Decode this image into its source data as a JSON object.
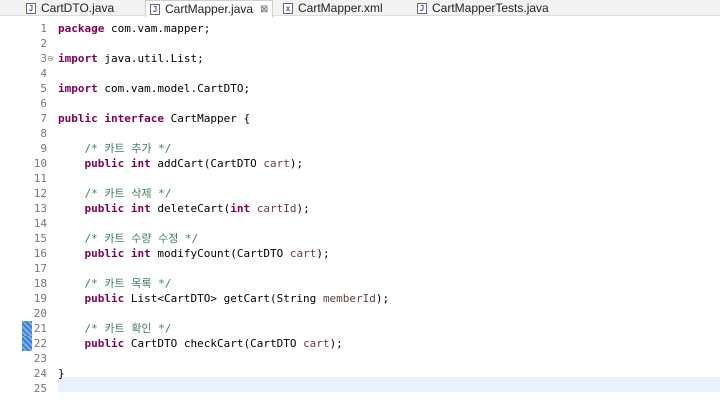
{
  "tabs": [
    {
      "label": "CartDTO.java",
      "icon": "java-file-icon",
      "glyph": "J",
      "active": false
    },
    {
      "label": "CartMapper.java",
      "icon": "java-file-icon",
      "glyph": "J",
      "active": true,
      "close": "⊠"
    },
    {
      "label": "CartMapper.xml",
      "icon": "xml-file-icon",
      "glyph": "x",
      "active": false
    },
    {
      "label": "CartMapperTests.java",
      "icon": "java-file-icon",
      "glyph": "J",
      "active": false
    }
  ],
  "code": {
    "current_line": 25,
    "lines": [
      {
        "n": "1",
        "tokens": [
          {
            "t": "kw",
            "v": "package"
          },
          {
            "t": "",
            "v": " com.vam.mapper;"
          }
        ]
      },
      {
        "n": "2",
        "tokens": []
      },
      {
        "n": "3",
        "fold": "⊖",
        "tokens": [
          {
            "t": "kw",
            "v": "import"
          },
          {
            "t": "",
            "v": " java.util.List;"
          }
        ]
      },
      {
        "n": "4",
        "tokens": []
      },
      {
        "n": "5",
        "tokens": [
          {
            "t": "kw",
            "v": "import"
          },
          {
            "t": "",
            "v": " com.vam.model.CartDTO;"
          }
        ]
      },
      {
        "n": "6",
        "tokens": []
      },
      {
        "n": "7",
        "tokens": [
          {
            "t": "kw",
            "v": "public"
          },
          {
            "t": "",
            "v": " "
          },
          {
            "t": "kw",
            "v": "interface"
          },
          {
            "t": "",
            "v": " CartMapper {"
          }
        ]
      },
      {
        "n": "8",
        "tokens": []
      },
      {
        "n": "9",
        "tokens": [
          {
            "t": "",
            "v": "    "
          },
          {
            "t": "cm",
            "v": "/* 카트 추가 */"
          }
        ]
      },
      {
        "n": "10",
        "tokens": [
          {
            "t": "",
            "v": "    "
          },
          {
            "t": "kw",
            "v": "public"
          },
          {
            "t": "",
            "v": " "
          },
          {
            "t": "kw",
            "v": "int"
          },
          {
            "t": "",
            "v": " addCart(CartDTO "
          },
          {
            "t": "pv",
            "v": "cart"
          },
          {
            "t": "",
            "v": ");"
          }
        ]
      },
      {
        "n": "11",
        "tokens": []
      },
      {
        "n": "12",
        "tokens": [
          {
            "t": "",
            "v": "    "
          },
          {
            "t": "cm",
            "v": "/* 카트 삭제 */"
          }
        ]
      },
      {
        "n": "13",
        "tokens": [
          {
            "t": "",
            "v": "    "
          },
          {
            "t": "kw",
            "v": "public"
          },
          {
            "t": "",
            "v": " "
          },
          {
            "t": "kw",
            "v": "int"
          },
          {
            "t": "",
            "v": " deleteCart("
          },
          {
            "t": "kw",
            "v": "int"
          },
          {
            "t": "",
            "v": " "
          },
          {
            "t": "pv",
            "v": "cartId"
          },
          {
            "t": "",
            "v": ");"
          }
        ]
      },
      {
        "n": "14",
        "tokens": []
      },
      {
        "n": "15",
        "tokens": [
          {
            "t": "",
            "v": "    "
          },
          {
            "t": "cm",
            "v": "/* 카트 수량 수정 */"
          }
        ]
      },
      {
        "n": "16",
        "tokens": [
          {
            "t": "",
            "v": "    "
          },
          {
            "t": "kw",
            "v": "public"
          },
          {
            "t": "",
            "v": " "
          },
          {
            "t": "kw",
            "v": "int"
          },
          {
            "t": "",
            "v": " modifyCount(CartDTO "
          },
          {
            "t": "pv",
            "v": "cart"
          },
          {
            "t": "",
            "v": ");"
          }
        ]
      },
      {
        "n": "17",
        "tokens": []
      },
      {
        "n": "18",
        "tokens": [
          {
            "t": "",
            "v": "    "
          },
          {
            "t": "cm",
            "v": "/* 카트 목록 */"
          }
        ]
      },
      {
        "n": "19",
        "tokens": [
          {
            "t": "",
            "v": "    "
          },
          {
            "t": "kw",
            "v": "public"
          },
          {
            "t": "",
            "v": " List<CartDTO> getCart(String "
          },
          {
            "t": "pv",
            "v": "memberId"
          },
          {
            "t": "",
            "v": ");"
          }
        ]
      },
      {
        "n": "20",
        "tokens": []
      },
      {
        "n": "21",
        "marker": true,
        "tokens": [
          {
            "t": "",
            "v": "    "
          },
          {
            "t": "cm",
            "v": "/* 카트 확인 */"
          }
        ]
      },
      {
        "n": "22",
        "marker": true,
        "tokens": [
          {
            "t": "",
            "v": "    "
          },
          {
            "t": "kw",
            "v": "public"
          },
          {
            "t": "",
            "v": " CartDTO checkCart(CartDTO "
          },
          {
            "t": "pv",
            "v": "cart"
          },
          {
            "t": "",
            "v": ");"
          }
        ]
      },
      {
        "n": "23",
        "tokens": []
      },
      {
        "n": "24",
        "tokens": [
          {
            "t": "",
            "v": "}"
          }
        ]
      },
      {
        "n": "25",
        "tokens": []
      }
    ]
  }
}
